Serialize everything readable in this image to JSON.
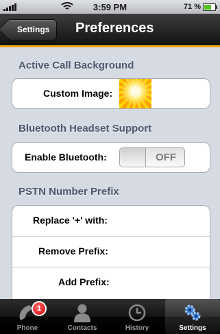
{
  "status_bar": {
    "time": "3:59 PM",
    "battery_text": "71 %",
    "battery_level": 0.71
  },
  "nav": {
    "back_label": "Settings",
    "title": "Preferences"
  },
  "sections": [
    {
      "header": "Active Call Background",
      "rows": [
        {
          "label": "Custom Image:"
        }
      ]
    },
    {
      "header": "Bluetooth Headset Support",
      "rows": [
        {
          "label": "Enable Bluetooth:",
          "toggle_text": "OFF"
        }
      ]
    },
    {
      "header": "PSTN Number Prefix",
      "rows": [
        {
          "label": "Replace '+' with:"
        },
        {
          "label": "Remove Prefix:"
        },
        {
          "label": "Add Prefix:"
        }
      ]
    }
  ],
  "tabs": [
    {
      "label": "Phone",
      "icon": "phone-icon",
      "badge": "1"
    },
    {
      "label": "Contacts",
      "icon": "person-icon"
    },
    {
      "label": "History",
      "icon": "clock-icon"
    },
    {
      "label": "Settings",
      "icon": "gears-icon",
      "active": true
    }
  ],
  "colors": {
    "accent": "#f0a80f",
    "background": "#d6dbe3",
    "section_header": "#4c566c"
  }
}
